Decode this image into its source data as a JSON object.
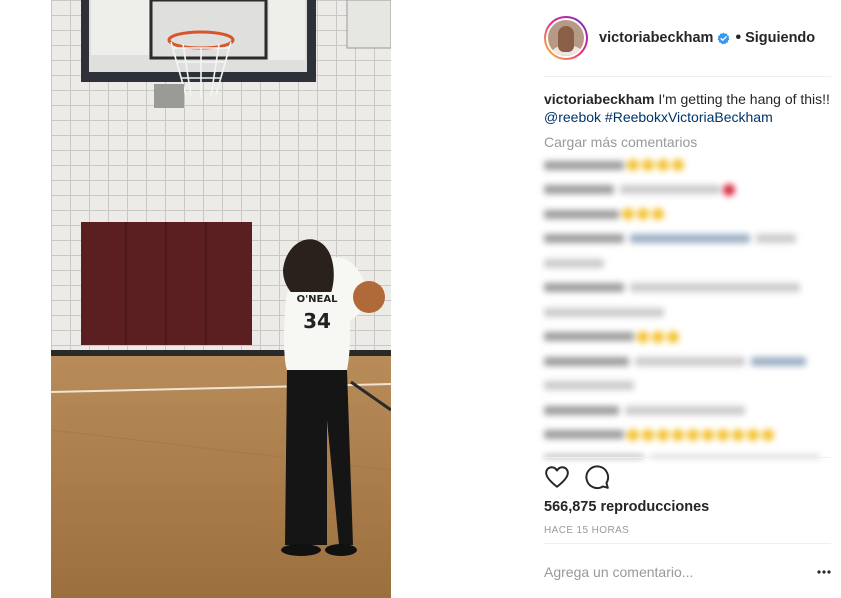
{
  "post": {
    "username": "victoriabeckham",
    "separator": "•",
    "follow_status": "Siguiendo",
    "caption_user": "victoriabeckham",
    "caption_text": " I'm getting the hang of this!! ",
    "caption_mentions": [
      "@reebok",
      "#ReebokxVictoriaBeckham"
    ],
    "load_more": "Cargar más comentarios",
    "views": "566,875 reproducciones",
    "time_ago": "HACE 15 HORAS",
    "comment_placeholder": "Agrega un comentario..."
  },
  "video": {
    "jersey_name": "O'NEAL",
    "jersey_number": "34"
  },
  "icons": {
    "like": "heart-icon",
    "comment": "comment-icon",
    "verified": "verified-badge-icon",
    "more": "more-options-icon"
  },
  "colors": {
    "link": "#003569",
    "verified": "#3897f0",
    "muted": "#999999",
    "text": "#262626"
  }
}
